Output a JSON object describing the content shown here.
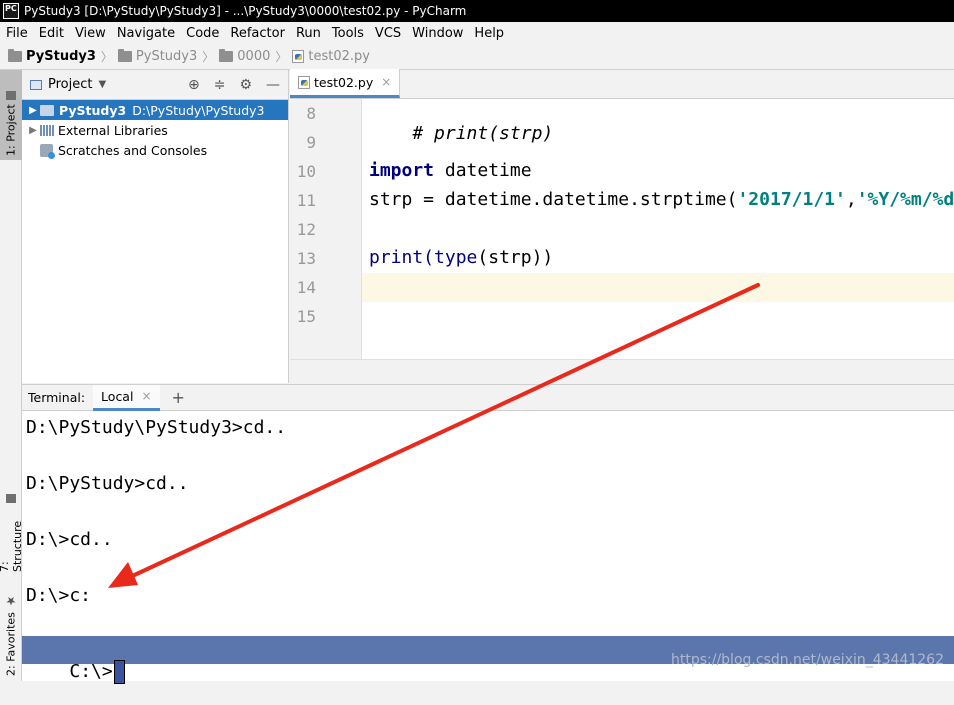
{
  "window": {
    "title": "PyStudy3 [D:\\PyStudy\\PyStudy3] - ...\\PyStudy3\\0000\\test02.py - PyCharm",
    "logo_text": "PC"
  },
  "menu": [
    "File",
    "Edit",
    "View",
    "Navigate",
    "Code",
    "Refactor",
    "Run",
    "Tools",
    "VCS",
    "Window",
    "Help"
  ],
  "breadcrumb": [
    "PyStudy3",
    "PyStudy3",
    "0000",
    "test02.py"
  ],
  "tool_strip": {
    "project": "1: Project",
    "structure": "7: Structure",
    "favorites": "2: Favorites"
  },
  "project_panel": {
    "title": "Project",
    "tree": [
      {
        "label": "PyStudy3",
        "path": "D:\\PyStudy\\PyStudy3",
        "selected": true
      },
      {
        "label": "External Libraries"
      },
      {
        "label": "Scratches and Consoles"
      }
    ]
  },
  "editor": {
    "tab": "test02.py",
    "line_numbers": [
      "8",
      "9",
      "10",
      "11",
      "12",
      "13",
      "14",
      "15"
    ],
    "lines": {
      "l8": "# print(strp)",
      "l10_kw": "import",
      "l10_rest": " datetime",
      "l11_a": "strp = datetime.datetime.strptime(",
      "l11_s1": "'2017/1/1'",
      "l11_b": ",",
      "l11_s2": "'%Y/%m/%d'",
      "l13_a": "print(",
      "l13_b": "type",
      "l13_c": "(strp))"
    }
  },
  "terminal": {
    "label": "Terminal:",
    "tab": "Local",
    "plus": "+",
    "lines": [
      "D:\\PyStudy\\PyStudy3>cd..",
      "D:\\PyStudy>cd..",
      "D:\\>cd..",
      "D:\\>c:"
    ],
    "prompt": "C:\\>"
  },
  "watermark": "https://blog.csdn.net/weixin_43441262",
  "colors": {
    "selection": "#2675bf",
    "arrow": "#e8291c",
    "terminal_highlight": "#5b76ad"
  }
}
